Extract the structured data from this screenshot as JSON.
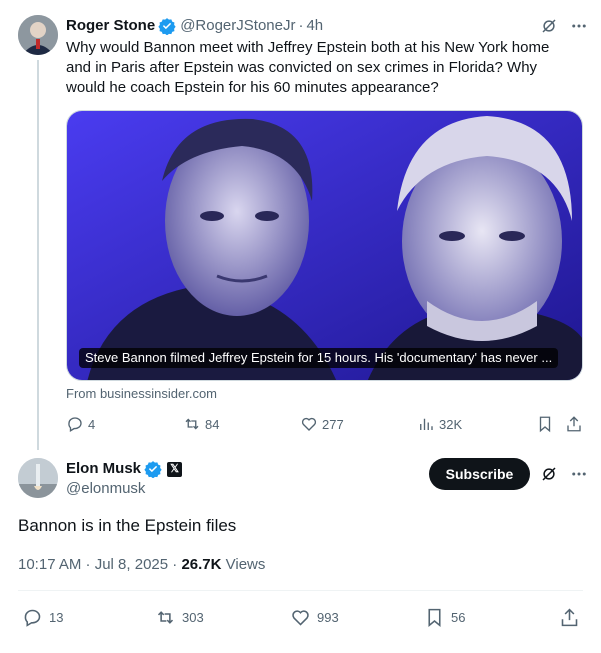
{
  "reply_to": {
    "display_name": "Roger Stone",
    "handle": "@RogerJStoneJr",
    "time": "4h",
    "text": "Why would Bannon meet with Jeffrey Epstein both at his New York home and in Paris after Epstein was convicted on sex crimes in Florida? Why would he coach Epstein for his 60 minutes appearance?",
    "media_caption": "Steve Bannon filmed Jeffrey Epstein for 15 hours. His 'documentary' has never ...",
    "source": "From businessinsider.com",
    "stats": {
      "replies": "4",
      "reposts": "84",
      "likes": "277",
      "views": "32K"
    }
  },
  "tweet": {
    "display_name": "Elon Musk",
    "handle": "@elonmusk",
    "subscribe_label": "Subscribe",
    "text": "Bannon is in the Epstein files",
    "timestamp": "10:17 AM · Jul 8, 2025 · ",
    "views_count": "26.7K",
    "views_label": " Views",
    "stats": {
      "replies": "13",
      "reposts": "303",
      "likes": "993",
      "bookmarks": "56"
    }
  },
  "colors": {
    "verified": "#1d9bf0",
    "secondary_text": "#536471",
    "media_tint": "#3a2fd6"
  }
}
